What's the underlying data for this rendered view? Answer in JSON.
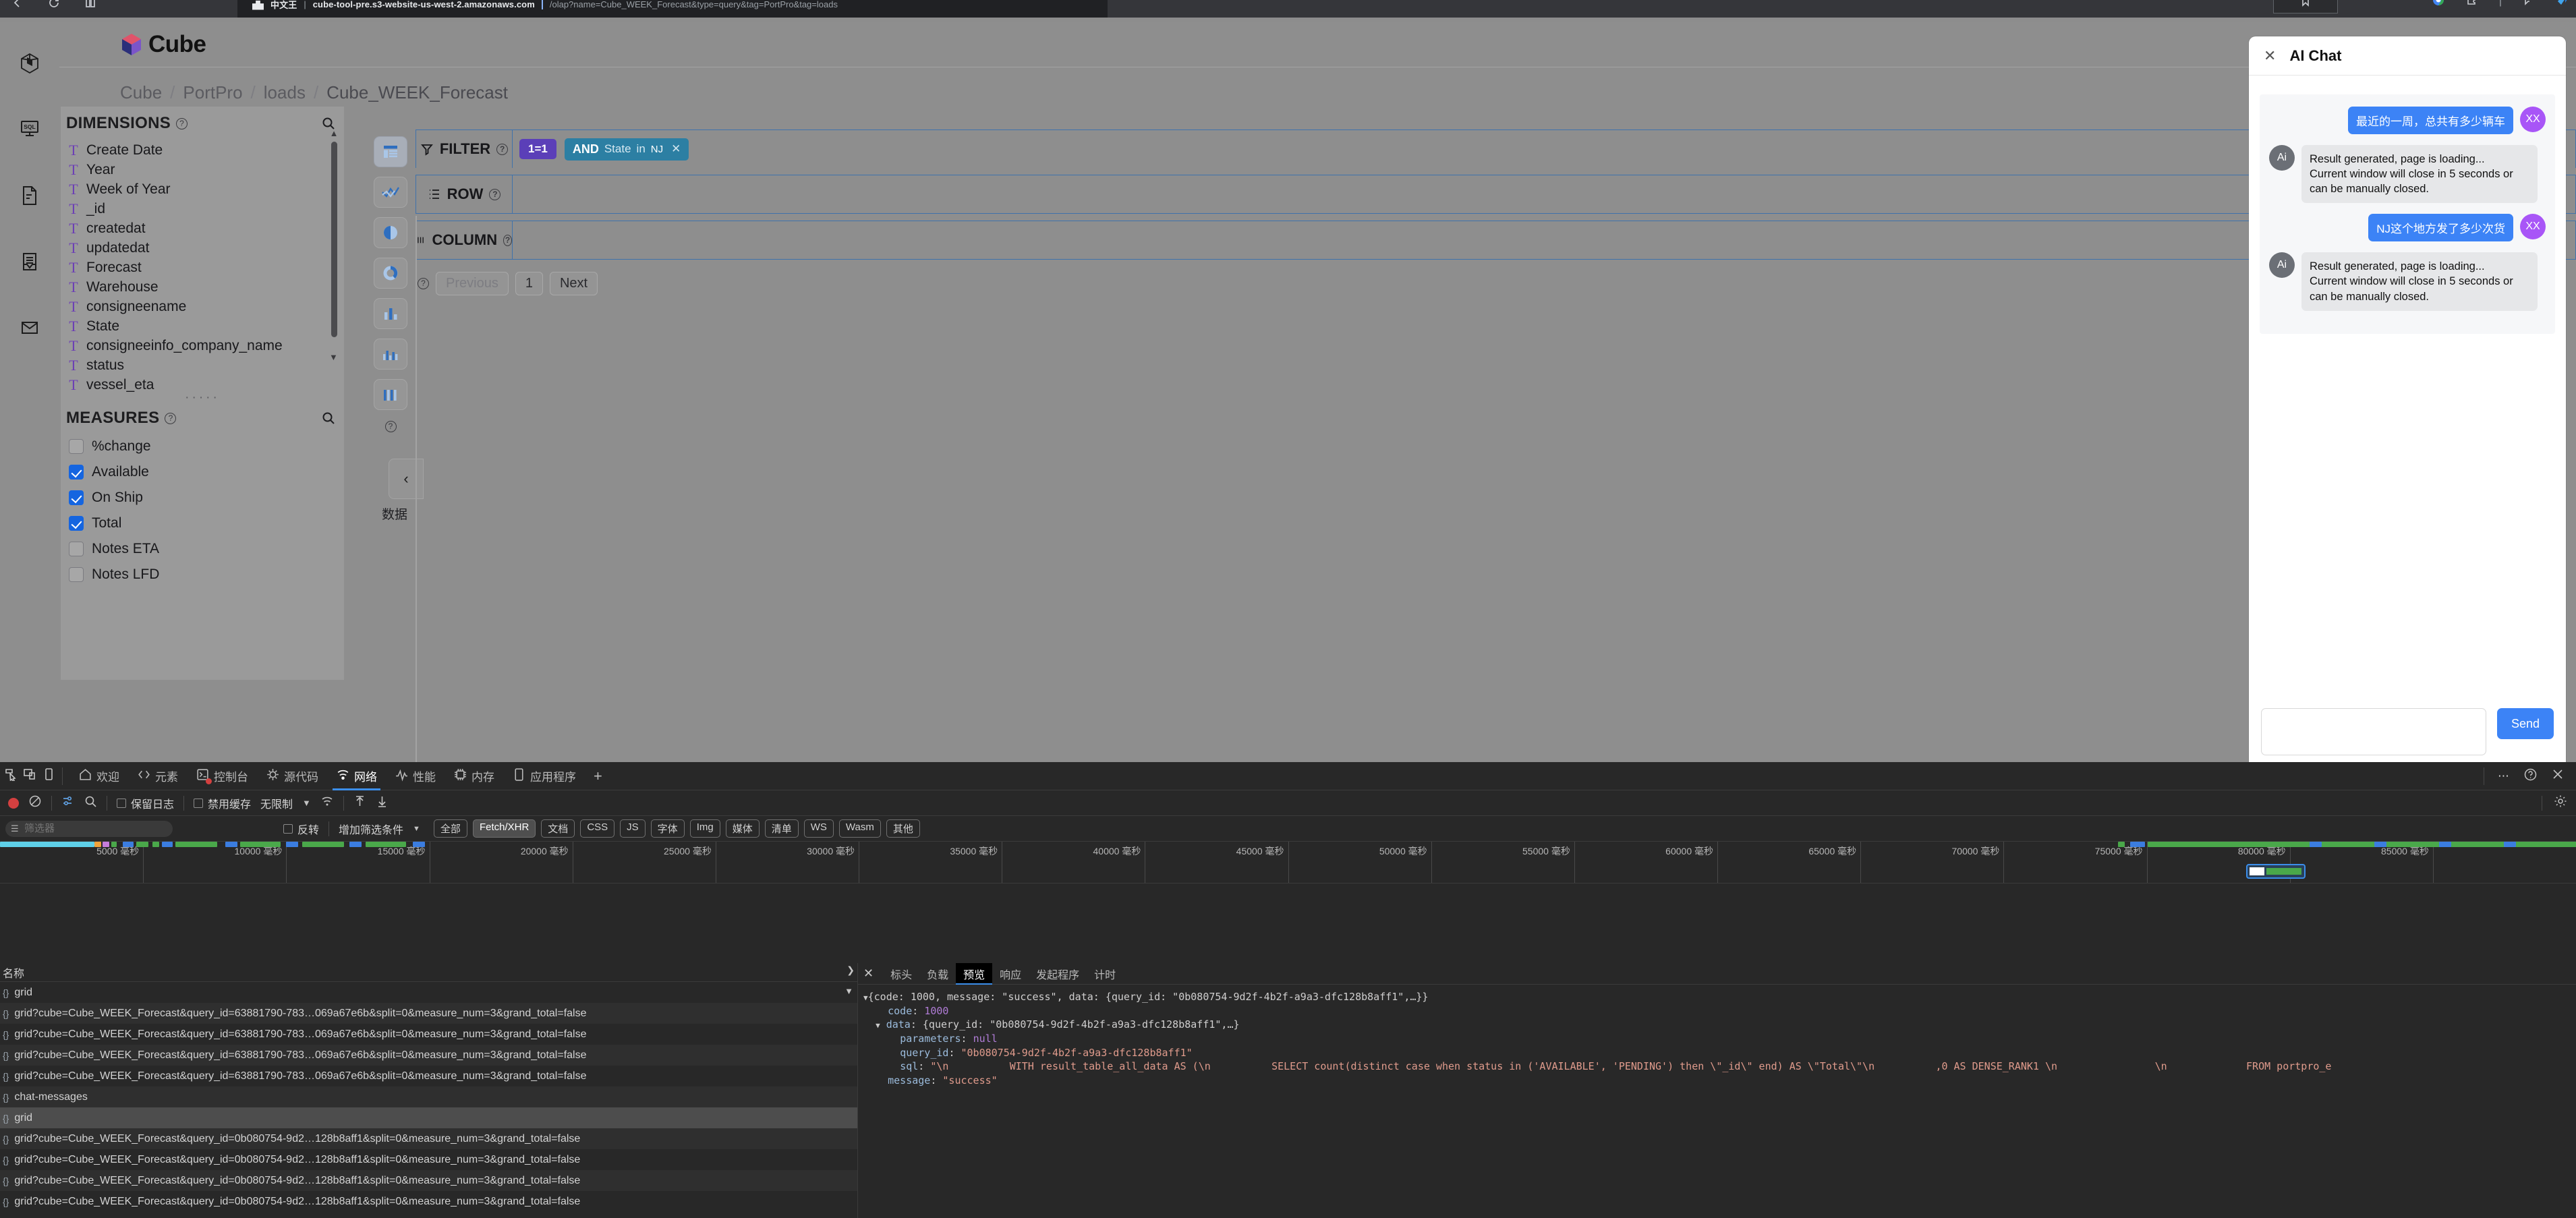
{
  "browser": {
    "tab_label_cn": "中文王",
    "tab_title": "cube-tool-pre.s3-website-us-west-2.amazonaws.com",
    "tab_url_rest": "/olap?name=Cube_WEEK_Forecast&type=query&tag=PortPro&tag=loads"
  },
  "app": {
    "logo_text": "Cube",
    "breadcrumb": [
      "Cube",
      "PortPro",
      "loads",
      "Cube_WEEK_Forecast"
    ],
    "rail_icons": [
      "cube-icon",
      "sql-icon",
      "document-icon",
      "report-icon",
      "mail-icon"
    ]
  },
  "dimensions": {
    "title": "DIMENSIONS",
    "items": [
      "Create Date",
      "Year",
      "Week of Year",
      "_id",
      "createdat",
      "updatedat",
      "Forecast",
      "Warehouse",
      "consigneename",
      "State",
      "consigneeinfo_company_name",
      "status",
      "vessel_eta"
    ]
  },
  "measures": {
    "title": "MEASURES",
    "items": [
      {
        "label": "%change",
        "checked": false
      },
      {
        "label": "Available",
        "checked": true
      },
      {
        "label": "On Ship",
        "checked": true
      },
      {
        "label": "Total",
        "checked": true
      },
      {
        "label": "Notes ETA",
        "checked": false
      },
      {
        "label": "Notes LFD",
        "checked": false
      }
    ]
  },
  "chart_rail": {
    "buttons": [
      "table-chart-icon",
      "line-chart-icon",
      "pie-chart-icon",
      "donut-chart-icon",
      "bar-chart-icon",
      "grouped-bar-chart-icon",
      "stacked-bar-chart-icon"
    ],
    "data_tab_label": "数据"
  },
  "query": {
    "filter_label": "FILTER",
    "row_label": "ROW",
    "column_label": "COLUMN",
    "chips": {
      "one_equals_one": "1=1",
      "bool": "AND",
      "field": "State",
      "operator": "in",
      "value": "NJ"
    },
    "pager": {
      "previous": "Previous",
      "page": "1",
      "next": "Next"
    }
  },
  "ai_chat": {
    "title": "AI Chat",
    "send_label": "Send",
    "input_value": "",
    "input_placeholder": "",
    "messages": [
      {
        "role": "user",
        "avatar": "XX",
        "text": "最近的一周，总共有多少辆车"
      },
      {
        "role": "ai",
        "avatar": "Ai",
        "text": "Result generated, page is loading...\nCurrent window will close in 5 seconds or can be manually closed."
      },
      {
        "role": "user",
        "avatar": "XX",
        "text": "NJ这个地方发了多少次货"
      },
      {
        "role": "ai",
        "avatar": "Ai",
        "text": "Result generated, page is loading...\nCurrent window will close in 5 seconds or can be manually closed."
      }
    ]
  },
  "devtools": {
    "tabs": [
      {
        "label": "欢迎",
        "icon": "home-icon",
        "active": false
      },
      {
        "label": "元素",
        "icon": "code-icon",
        "active": false
      },
      {
        "label": "控制台",
        "icon": "console-icon",
        "active": false,
        "badge": "error"
      },
      {
        "label": "源代码",
        "icon": "sources-icon",
        "active": false
      },
      {
        "label": "网络",
        "icon": "network-icon",
        "active": true
      },
      {
        "label": "性能",
        "icon": "performance-icon",
        "active": false
      },
      {
        "label": "内存",
        "icon": "memory-icon",
        "active": false
      },
      {
        "label": "应用程序",
        "icon": "application-icon",
        "active": false
      }
    ],
    "add_tab": "+",
    "toolbar": {
      "preserve_log": "保留日志",
      "disable_cache": "禁用缓存",
      "throttling": "无限制"
    },
    "filterbar": {
      "filter_placeholder": "筛选器",
      "invert": "反转",
      "more_filters": "增加筛选条件",
      "types": [
        "全部",
        "Fetch/XHR",
        "文档",
        "CSS",
        "JS",
        "字体",
        "Img",
        "媒体",
        "清单",
        "WS",
        "Wasm",
        "其他"
      ],
      "active_type": "Fetch/XHR"
    },
    "timeline": {
      "unit": "毫秒",
      "ticks": [
        5000,
        10000,
        15000,
        20000,
        25000,
        30000,
        35000,
        40000,
        45000,
        50000,
        55000,
        60000,
        65000,
        70000,
        75000,
        80000,
        85000
      ]
    },
    "requests": {
      "column_header": "名称",
      "rows": [
        {
          "name": "grid",
          "selected": false
        },
        {
          "name": "grid?cube=Cube_WEEK_Forecast&query_id=63881790-783…069a67e6b&split=0&measure_num=3&grand_total=false",
          "selected": false
        },
        {
          "name": "grid?cube=Cube_WEEK_Forecast&query_id=63881790-783…069a67e6b&split=0&measure_num=3&grand_total=false",
          "selected": false
        },
        {
          "name": "grid?cube=Cube_WEEK_Forecast&query_id=63881790-783…069a67e6b&split=0&measure_num=3&grand_total=false",
          "selected": false
        },
        {
          "name": "grid?cube=Cube_WEEK_Forecast&query_id=63881790-783…069a67e6b&split=0&measure_num=3&grand_total=false",
          "selected": false
        },
        {
          "name": "chat-messages",
          "selected": false
        },
        {
          "name": "grid",
          "selected": true
        },
        {
          "name": "grid?cube=Cube_WEEK_Forecast&query_id=0b080754-9d2…128b8aff1&split=0&measure_num=3&grand_total=false",
          "selected": false
        },
        {
          "name": "grid?cube=Cube_WEEK_Forecast&query_id=0b080754-9d2…128b8aff1&split=0&measure_num=3&grand_total=false",
          "selected": false
        },
        {
          "name": "grid?cube=Cube_WEEK_Forecast&query_id=0b080754-9d2…128b8aff1&split=0&measure_num=3&grand_total=false",
          "selected": false
        },
        {
          "name": "grid?cube=Cube_WEEK_Forecast&query_id=0b080754-9d2…128b8aff1&split=0&measure_num=3&grand_total=false",
          "selected": false
        }
      ]
    },
    "detail": {
      "tabs": [
        "标头",
        "负载",
        "预览",
        "响应",
        "发起程序",
        "计时"
      ],
      "active_tab": "预览",
      "preview": {
        "line1": "{code: 1000, message: \"success\", data: {query_id: \"0b080754-9d2f-4b2f-a9a3-dfc128b8aff1\",…}}",
        "code_key": "code",
        "code_val": "1000",
        "data_key": "data",
        "data_val": "{query_id: \"0b080754-9d2f-4b2f-a9a3-dfc128b8aff1\",…}",
        "parameters_key": "parameters",
        "parameters_val": "null",
        "query_id_key": "query_id",
        "query_id_val": "\"0b080754-9d2f-4b2f-a9a3-dfc128b8aff1\"",
        "sql_key": "sql",
        "sql_val_a": "\"\\n          WITH result_table_all_data AS (\\n",
        "sql_val_b": "SELECT count(distinct case when status in ('AVAILABLE', 'PENDING') then \\\"_id\\\" end) AS \\\"Total\\\"\\n",
        "sql_val_c": ",0 AS DENSE_RANK1 \\n",
        "sql_val_d": "\\n",
        "sql_val_e": "FROM portpro_e",
        "message_key": "message",
        "message_val": "\"success\""
      }
    }
  }
}
